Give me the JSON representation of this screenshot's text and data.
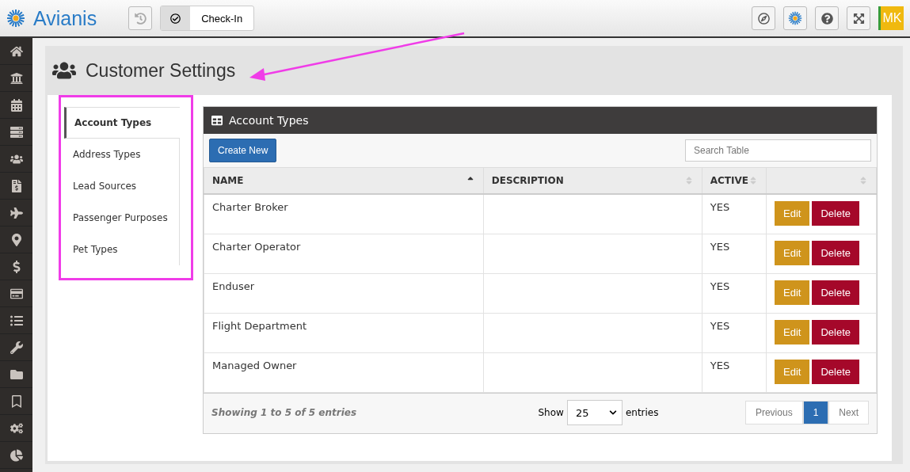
{
  "header": {
    "logo": "Avianis",
    "checkin": "Check-In",
    "avatar": "MK"
  },
  "page_title": "Customer Settings",
  "tabs": [
    {
      "label": "Account Types",
      "selected": true
    },
    {
      "label": "Address Types",
      "selected": false
    },
    {
      "label": "Lead Sources",
      "selected": false
    },
    {
      "label": "Passenger Purposes",
      "selected": false
    },
    {
      "label": "Pet Types",
      "selected": false
    }
  ],
  "panel": {
    "title": "Account Types",
    "create_button": "Create New",
    "search": {
      "placeholder": "Search Table"
    }
  },
  "table": {
    "columns": [
      {
        "label": "NAME",
        "sorted": true
      },
      {
        "label": "DESCRIPTION",
        "sorted": false
      },
      {
        "label": "ACTIVE",
        "sorted": false
      },
      {
        "sorted": false
      }
    ],
    "rows": [
      {
        "name": "Charter Broker",
        "active": "YES",
        "edit": "Edit",
        "delete": "Delete"
      },
      {
        "name": "Charter Operator",
        "active": "YES",
        "edit": "Edit",
        "delete": "Delete"
      },
      {
        "name": "Enduser",
        "active": "YES",
        "edit": "Edit",
        "delete": "Delete"
      },
      {
        "name": "Flight Department",
        "active": "YES",
        "edit": "Edit",
        "delete": "Delete"
      },
      {
        "name": "Managed Owner",
        "active": "YES",
        "edit": "Edit",
        "delete": "Delete"
      }
    ]
  },
  "footer": {
    "info": "Showing 1 to 5 of 5 entries",
    "show": "Show",
    "page_size": "25",
    "entries": "entries",
    "previous": "Previous",
    "pages": [
      {
        "label": "1",
        "selected": true
      }
    ],
    "next": "Next"
  }
}
